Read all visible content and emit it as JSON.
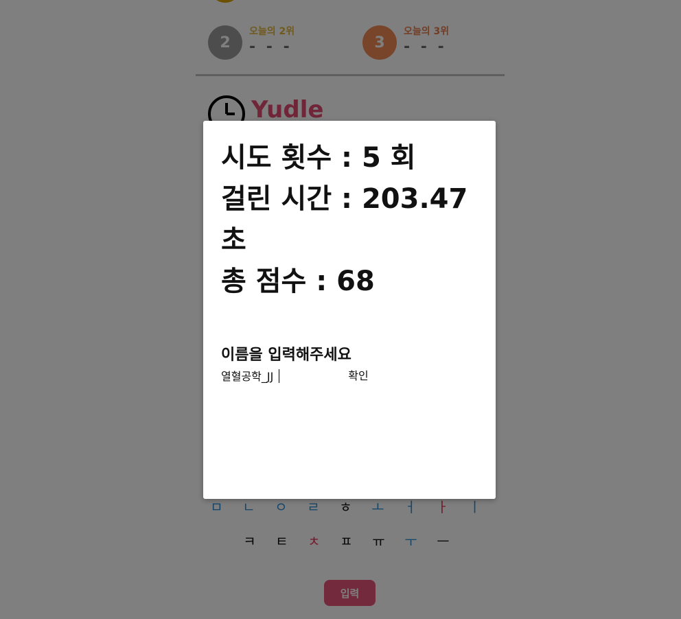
{
  "background": {
    "top_rank_color": "#d8a300",
    "rank2": {
      "number": "2",
      "label": "오늘의 2위",
      "name": "- - -"
    },
    "rank3": {
      "number": "3",
      "label": "오늘의 3위",
      "name": "- - -"
    },
    "logo_text": "Yudle",
    "keyboard": {
      "row1": [
        "ㅁ",
        "ㄴ",
        "ㅇ",
        "ㄹ",
        "ㅎ",
        "ㅗ",
        "ㅓ",
        "ㅏ",
        "ㅣ"
      ],
      "row2": [
        "ㅋ",
        "ㅌ",
        "ㅊ",
        "ㅍ",
        "ㅠ",
        "ㅜ",
        "ㅡ"
      ]
    },
    "submit_label": "입력"
  },
  "modal": {
    "attempts_line": "시도 횟수 : 5 회",
    "time_line": "걸린 시간 : 203.47",
    "time_unit": "초",
    "score_line": "총 점수 : 68",
    "name_prompt": "이름을 입력해주세요",
    "name_value": "열혈공학_JJ",
    "confirm_label": "확인"
  }
}
